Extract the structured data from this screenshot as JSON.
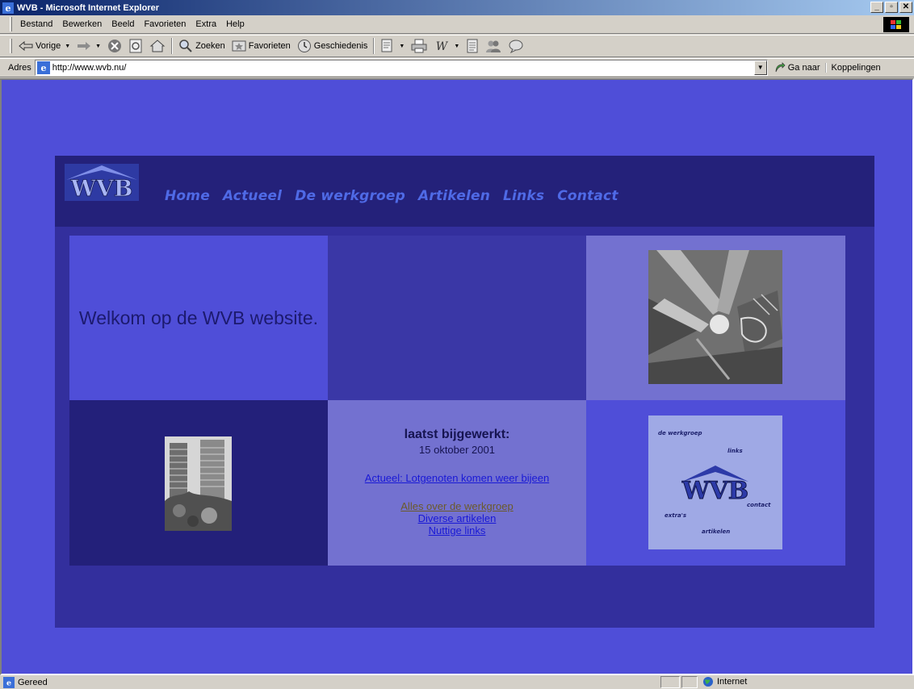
{
  "window": {
    "title": "WVB - Microsoft Internet Explorer",
    "minimize": "_",
    "restore": "▫",
    "close": "✕"
  },
  "menu": [
    "Bestand",
    "Bewerken",
    "Beeld",
    "Favorieten",
    "Extra",
    "Help"
  ],
  "toolbar": {
    "back": "Vorige",
    "search": "Zoeken",
    "favorites": "Favorieten",
    "history": "Geschiedenis"
  },
  "address": {
    "label": "Adres",
    "url": "http://www.wvb.nu/",
    "go": "Ga naar",
    "links": "Koppelingen"
  },
  "page": {
    "logo_text": "WVB",
    "nav": [
      "Home",
      "Actueel",
      "De werkgroep",
      "Artikelen",
      "Links",
      "Contact"
    ],
    "welcome": "Welkom op de WVB website.",
    "updated_label": "laatst bijgewerkt:",
    "updated_date": "15 oktober 2001",
    "news_link": "Actueel: Lotgenoten komen weer bijeen",
    "links": [
      "Alles over de werkgroep",
      "Diverse artikelen",
      "Nuttige links"
    ],
    "logo_collage": {
      "logo": "WVB",
      "words": [
        "de werkgroep",
        "links",
        "contact",
        "extra's",
        "artikelen"
      ]
    }
  },
  "status": {
    "text": "Gereed",
    "zone": "Internet"
  },
  "colors": {
    "page_bg": "#4f4ed8",
    "nav_text": "#4f6ae6",
    "link": "#1919d6",
    "visited_link": "#6b5a2a"
  }
}
